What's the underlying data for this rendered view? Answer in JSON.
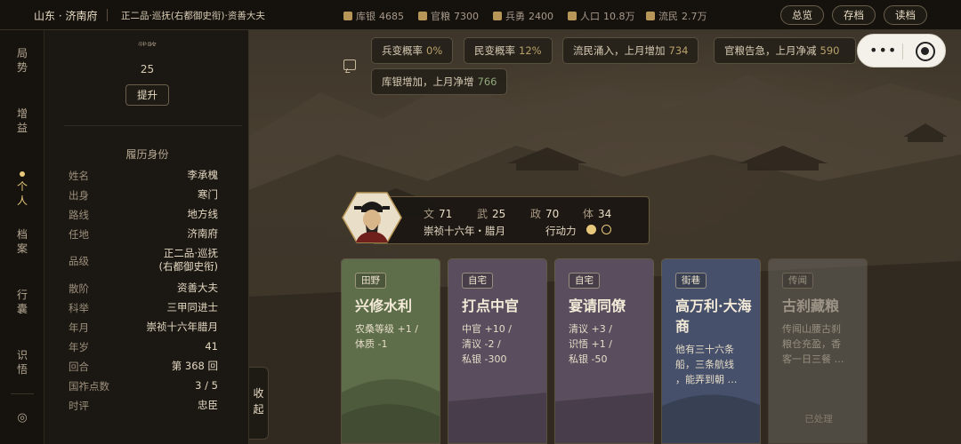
{
  "topbar": {
    "location": "山东 · 济南府",
    "rank": "正二品·巡抚(右都御史衔)·资善大夫",
    "resources": [
      {
        "icon": "silver-icon",
        "label": "库银",
        "value": "4685"
      },
      {
        "icon": "grain-icon",
        "label": "官粮",
        "value": "7300"
      },
      {
        "icon": "soldier-icon",
        "label": "兵勇",
        "value": "2400"
      },
      {
        "icon": "population-icon",
        "label": "人口",
        "value": "10.8万"
      },
      {
        "icon": "refugee-icon",
        "label": "流民",
        "value": "2.7万"
      }
    ],
    "buttons": {
      "overview": "总览",
      "save": "存档",
      "load": "读档"
    }
  },
  "nav": {
    "items": [
      "局\n势",
      "增\n益",
      "个\n人",
      "档\n案",
      "行\n囊",
      "识\n悟"
    ],
    "active_index": 2
  },
  "profile": {
    "martial_label": "武略",
    "martial_value": "25",
    "upgrade": "提升",
    "section_title": "履历身份",
    "rows": [
      {
        "k": "姓名",
        "v": "李承槐"
      },
      {
        "k": "出身",
        "v": "寒门"
      },
      {
        "k": "路线",
        "v": "地方线"
      },
      {
        "k": "任地",
        "v": "济南府"
      },
      {
        "k": "品级",
        "v": "正二品·巡抚\n(右都御史衔)"
      },
      {
        "k": "散阶",
        "v": "资善大夫"
      },
      {
        "k": "科举",
        "v": "三甲同进士"
      },
      {
        "k": "年月",
        "v": "崇祯十六年腊月"
      },
      {
        "k": "年岁",
        "v": "41"
      },
      {
        "k": "回合",
        "v": "第 368 回"
      },
      {
        "k": "国祚点数",
        "v": "3 / 5"
      },
      {
        "k": "时评",
        "v": "忠臣"
      }
    ],
    "collapse": "收\n起"
  },
  "alerts": [
    {
      "text": "兵变概率",
      "num": "0%"
    },
    {
      "text": "民变概率",
      "num": "12%"
    },
    {
      "text": "流民涌入，上月增加",
      "num": "734"
    },
    {
      "text": "官粮告急，上月净减",
      "num": "590"
    },
    {
      "text": "库银增加，上月净增",
      "num": "766"
    }
  ],
  "character": {
    "attrs": [
      {
        "label": "文",
        "value": "71"
      },
      {
        "label": "武",
        "value": "25"
      },
      {
        "label": "政",
        "value": "70"
      },
      {
        "label": "体",
        "value": "34"
      }
    ],
    "date": "崇祯十六年・腊月",
    "action_label": "行动力",
    "action_points": {
      "filled": 1,
      "total": 2
    }
  },
  "cards": [
    {
      "tag": "田野",
      "title": "兴修水利",
      "desc": "农桑等级 +1 /\n体质 -1",
      "color": "#5e6e4a",
      "handled": ""
    },
    {
      "tag": "自宅",
      "title": "打点中官",
      "desc": "中官 +10 /\n清议 -2 /\n私银 -300",
      "color": "#5a4e5e",
      "handled": ""
    },
    {
      "tag": "自宅",
      "title": "宴请同僚",
      "desc": "清议 +3 /\n识悟 +1 /\n私银 -50",
      "color": "#5a4e5e",
      "handled": ""
    },
    {
      "tag": "街巷",
      "title": "高万利·大海商",
      "desc": "他有三十六条\n船，三条航线\n，能弄到朝 …",
      "color": "#46506a",
      "handled": ""
    },
    {
      "tag": "传闻",
      "title": "古刹藏粮",
      "desc": "传闻山腰古刹\n粮仓充盈，香\n客一日三餐 …",
      "color": "#6a6660",
      "handled": "已处理"
    }
  ],
  "colors": {
    "accent": "#e8c87a",
    "panel": "#1b1712",
    "number_gold": "#b9a16a",
    "number_green": "#8fa77a"
  }
}
